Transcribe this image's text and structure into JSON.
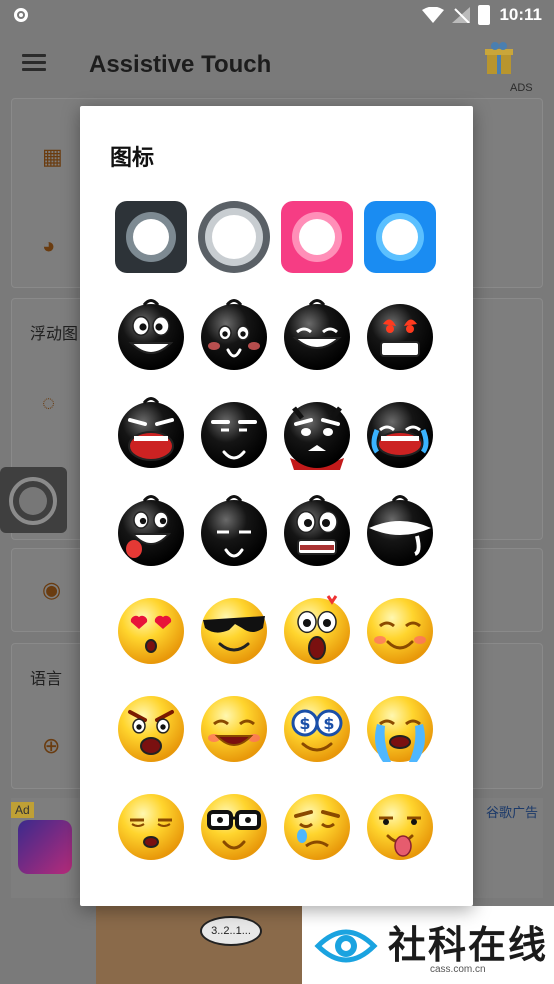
{
  "status_bar": {
    "time": "10:11"
  },
  "app_bar": {
    "title": "Assistive Touch",
    "ads_label": "ADS"
  },
  "background": {
    "section_floating": "浮动图",
    "section_language": "语言",
    "ad_badge": "Ad",
    "google_ad": "谷歌广告",
    "speech_text": "3..2..1..."
  },
  "watermark": {
    "title": "社科在线",
    "url": "cass.com.cn"
  },
  "dialog": {
    "title": "图标",
    "icons": [
      {
        "name": "dark-square-ring-icon"
      },
      {
        "name": "grey-round-ring-icon"
      },
      {
        "name": "pink-square-ring-icon"
      },
      {
        "name": "blue-square-ring-icon"
      },
      {
        "name": "black-smiley-big-grin-icon"
      },
      {
        "name": "black-smiley-shy-icon"
      },
      {
        "name": "black-smiley-laughing-icon"
      },
      {
        "name": "black-smiley-angry-fire-icon"
      },
      {
        "name": "black-smiley-shouting-icon"
      },
      {
        "name": "black-smiley-grumpy-icon"
      },
      {
        "name": "black-smiley-devil-icon"
      },
      {
        "name": "black-smiley-crying-icon"
      },
      {
        "name": "black-smiley-tongue-icon"
      },
      {
        "name": "black-smiley-smirk-icon"
      },
      {
        "name": "black-smiley-shocked-icon"
      },
      {
        "name": "black-smiley-drooling-icon"
      },
      {
        "name": "yellow-smiley-heart-eyes-icon"
      },
      {
        "name": "yellow-smiley-sunglasses-icon"
      },
      {
        "name": "yellow-smiley-surprised-icon"
      },
      {
        "name": "yellow-smiley-content-icon"
      },
      {
        "name": "yellow-smiley-angry-icon"
      },
      {
        "name": "yellow-smiley-happy-icon"
      },
      {
        "name": "yellow-smiley-money-eyes-icon"
      },
      {
        "name": "yellow-smiley-tears-icon"
      },
      {
        "name": "yellow-smiley-rolling-eyes-icon"
      },
      {
        "name": "yellow-smiley-nerd-glasses-icon"
      },
      {
        "name": "yellow-smiley-sad-tear-icon"
      },
      {
        "name": "yellow-smiley-tongue-out-icon"
      }
    ]
  },
  "colors": {
    "accent_orange": "#d35400",
    "pink": "#f63d84",
    "blue": "#1a8cf2",
    "dark": "#2d3338"
  }
}
